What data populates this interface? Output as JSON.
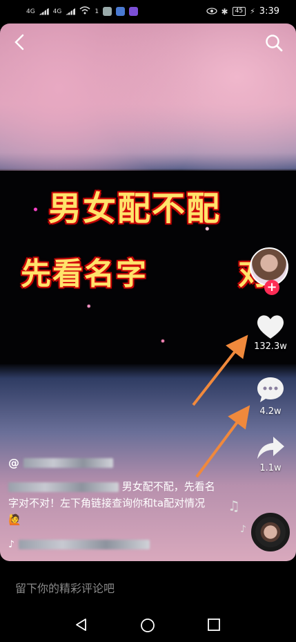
{
  "status_bar": {
    "signal_1": "4G",
    "signal_2": "4G",
    "superscript": "1",
    "battery": "45",
    "time": "3:39"
  },
  "video": {
    "headline_line1": "男女配不配",
    "headline_line2": "先看名字",
    "headline_line2_end": "对"
  },
  "rail": {
    "like_count": "132.3w",
    "comment_count": "4.2w",
    "share_count": "1.1w",
    "follow_symbol": "+"
  },
  "post": {
    "author_prefix": "@",
    "description": "男女配不配，先看名字对不对！左下角链接查询你和ta配对情况🙋"
  },
  "comment_input": {
    "placeholder": "留下你的精彩评论吧"
  },
  "colors": {
    "follow_badge": "#fe2c55",
    "arrow": "#f0893c",
    "headline_text": "#ffe36b",
    "headline_outline": "#cc0000"
  },
  "icons": [
    "back-icon",
    "search-icon",
    "heart-icon",
    "comment-icon",
    "share-icon",
    "music-note-icon",
    "nav-back-icon",
    "nav-home-icon",
    "nav-recents-icon"
  ]
}
